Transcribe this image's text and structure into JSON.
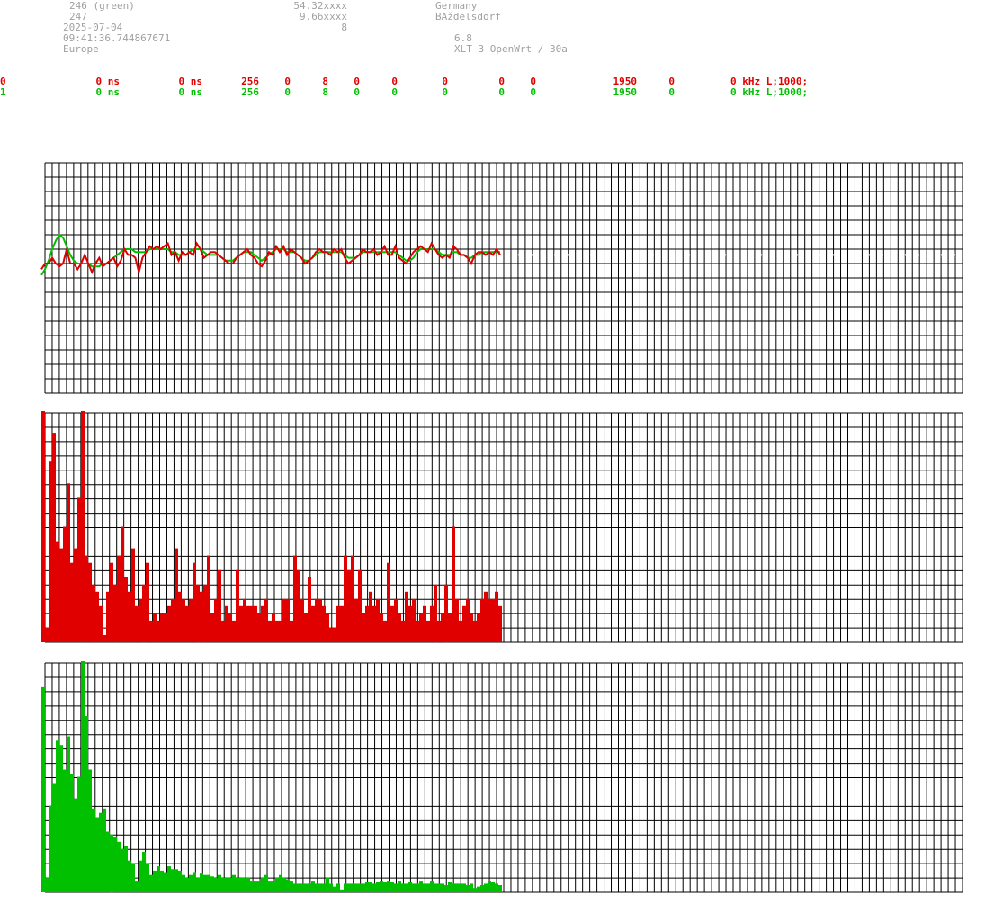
{
  "header": {
    "left": [
      "246 (green)",
      "247",
      "2025-07-04",
      "09:41:36.744867671",
      "Europe"
    ],
    "middle": [
      "54.32xxxx",
      "9.66xxxx",
      "8"
    ],
    "right": [
      "Germany",
      "BAždelsdorf",
      "",
      "6.8",
      "XLT 3 OpenWrt / 30a"
    ]
  },
  "rows": [
    {
      "id": "0",
      "v1": "0 ns",
      "v2": "0 ns",
      "n1": "256",
      "n2": "0",
      "n3": "8",
      "n4": "0",
      "n5": "0",
      "n6": "0",
      "n7": "0",
      "n8": "0",
      "freq": "1950",
      "n9": "0",
      "tail": "0 kHz L;1000;"
    },
    {
      "id": "1",
      "v1": "0 ns",
      "v2": "0 ns",
      "n1": "256",
      "n2": "0",
      "n3": "8",
      "n4": "0",
      "n5": "0",
      "n6": "0",
      "n7": "0",
      "n8": "0",
      "freq": "1950",
      "n9": "0",
      "tail": "0 kHz L;1000;"
    }
  ],
  "colors": {
    "red": "#e00000",
    "green": "#00c000",
    "grid": "#000000",
    "header_text": "#a0a0a0"
  },
  "chart_data": [
    {
      "type": "line",
      "x": [
        0,
        1,
        2,
        3,
        4,
        5,
        6,
        7,
        8,
        9,
        10,
        11,
        12,
        13,
        14,
        15,
        16,
        17,
        18,
        19,
        20,
        21,
        22,
        23,
        24,
        25,
        26,
        27,
        28,
        29,
        30,
        31,
        32,
        33,
        34,
        35,
        36,
        37,
        38,
        39,
        40,
        41,
        42,
        43,
        44,
        45,
        46,
        47,
        48,
        49,
        50,
        51,
        52,
        53,
        54,
        55,
        56,
        57,
        58,
        59,
        60,
        61,
        62,
        63,
        64,
        65,
        66,
        67,
        68,
        69,
        70,
        71,
        72,
        73,
        74,
        75,
        76,
        77,
        78,
        79,
        80,
        81,
        82,
        83,
        84,
        85,
        86,
        87,
        88,
        89,
        90,
        91,
        92,
        93,
        94,
        95,
        96,
        97,
        98,
        99,
        100,
        101,
        102,
        103,
        104,
        105,
        106,
        107,
        108,
        109,
        110,
        111,
        112,
        113,
        114,
        115,
        116,
        117,
        118,
        119,
        120,
        121,
        122,
        123,
        124,
        125,
        126,
        127
      ],
      "series": [
        {
          "values": [
            0.6,
            1.0,
            1.0,
            1.4,
            1.0,
            0.8,
            1.0,
            2.0,
            1.0,
            1.0,
            0.6,
            1.0,
            1.6,
            1.0,
            0.4,
            1.0,
            1.4,
            0.8,
            1.0,
            1.2,
            1.4,
            0.8,
            1.2,
            2.0,
            1.6,
            1.6,
            1.4,
            0.4,
            1.4,
            1.8,
            2.2,
            2.0,
            2.2,
            2.0,
            2.2,
            2.4,
            1.6,
            1.8,
            1.2,
            1.8,
            1.6,
            1.8,
            1.6,
            2.4,
            2.0,
            1.4,
            1.6,
            1.8,
            1.8,
            1.6,
            1.4,
            1.2,
            1.0,
            1.0,
            1.4,
            1.6,
            1.8,
            2.0,
            1.6,
            1.4,
            1.0,
            0.8,
            1.2,
            1.8,
            1.6,
            2.2,
            1.8,
            2.2,
            1.6,
            2.0,
            1.8,
            1.6,
            1.4,
            1.0,
            1.2,
            1.4,
            1.8,
            2.0,
            1.8,
            1.8,
            1.6,
            2.0,
            1.8,
            2.0,
            1.4,
            1.0,
            1.2,
            1.4,
            1.6,
            2.0,
            1.8,
            1.8,
            2.0,
            1.6,
            1.8,
            2.2,
            1.6,
            1.6,
            2.2,
            1.4,
            1.2,
            1.0,
            1.4,
            1.8,
            2.0,
            2.2,
            2.0,
            1.8,
            2.4,
            2.0,
            1.6,
            1.4,
            1.6,
            1.4,
            2.2,
            2.0,
            1.6,
            1.6,
            1.4,
            1.0,
            1.6,
            1.8,
            1.8,
            1.6,
            1.8,
            1.6,
            2.0,
            1.6
          ]
        },
        {
          "values": [
            0.2,
            0.6,
            1.2,
            2.0,
            2.6,
            3.0,
            2.8,
            2.2,
            1.6,
            1.2,
            1.0,
            1.0,
            1.0,
            1.0,
            0.8,
            0.8,
            0.8,
            1.0,
            1.0,
            1.2,
            1.4,
            1.6,
            1.8,
            2.0,
            2.0,
            2.0,
            1.8,
            1.8,
            1.8,
            1.8,
            2.0,
            2.0,
            2.0,
            2.0,
            2.0,
            2.0,
            1.8,
            1.8,
            1.6,
            1.6,
            1.6,
            1.8,
            2.0,
            2.0,
            2.0,
            1.8,
            1.6,
            1.6,
            1.6,
            1.6,
            1.4,
            1.2,
            1.2,
            1.2,
            1.4,
            1.6,
            1.8,
            1.8,
            1.8,
            1.6,
            1.4,
            1.2,
            1.4,
            1.6,
            1.8,
            2.0,
            2.0,
            2.0,
            1.8,
            1.8,
            1.8,
            1.6,
            1.4,
            1.2,
            1.2,
            1.4,
            1.6,
            1.8,
            1.8,
            1.8,
            1.8,
            1.8,
            1.8,
            1.8,
            1.6,
            1.4,
            1.4,
            1.4,
            1.6,
            1.8,
            1.8,
            1.8,
            1.8,
            1.8,
            1.8,
            1.8,
            1.8,
            1.8,
            1.8,
            1.6,
            1.4,
            1.2,
            1.2,
            1.4,
            1.8,
            2.0,
            2.0,
            2.0,
            2.0,
            2.0,
            1.8,
            1.6,
            1.6,
            1.6,
            1.8,
            1.8,
            1.6,
            1.6,
            1.4,
            1.4,
            1.6,
            1.6,
            1.8,
            1.8,
            1.8,
            1.8,
            1.8,
            1.8
          ]
        }
      ],
      "ylim": [
        -8,
        8
      ],
      "xlim": [
        0,
        256
      ],
      "grid": true
    },
    {
      "type": "bar",
      "x": [
        0,
        1,
        2,
        3,
        4,
        5,
        6,
        7,
        8,
        9,
        10,
        11,
        12,
        13,
        14,
        15,
        16,
        17,
        18,
        19,
        20,
        21,
        22,
        23,
        24,
        25,
        26,
        27,
        28,
        29,
        30,
        31,
        32,
        33,
        34,
        35,
        36,
        37,
        38,
        39,
        40,
        41,
        42,
        43,
        44,
        45,
        46,
        47,
        48,
        49,
        50,
        51,
        52,
        53,
        54,
        55,
        56,
        57,
        58,
        59,
        60,
        61,
        62,
        63,
        64,
        65,
        66,
        67,
        68,
        69,
        70,
        71,
        72,
        73,
        74,
        75,
        76,
        77,
        78,
        79,
        80,
        81,
        82,
        83,
        84,
        85,
        86,
        87,
        88,
        89,
        90,
        91,
        92,
        93,
        94,
        95,
        96,
        97,
        98,
        99,
        100,
        101,
        102,
        103,
        104,
        105,
        106,
        107,
        108,
        109,
        110,
        111,
        112,
        113,
        114,
        115,
        116,
        117,
        118,
        119,
        120,
        121,
        122,
        123,
        124,
        125,
        126,
        127
      ],
      "values": [
        16.0,
        1.0,
        12.5,
        14.5,
        7.0,
        6.5,
        8.0,
        11.0,
        5.5,
        6.5,
        10.0,
        16.0,
        6.0,
        5.5,
        4.0,
        3.5,
        2.5,
        0.5,
        3.5,
        5.5,
        4.0,
        6.0,
        8.0,
        4.5,
        3.5,
        6.5,
        2.5,
        3.0,
        4.0,
        5.5,
        1.5,
        2.0,
        1.5,
        2.0,
        2.0,
        2.5,
        3.0,
        6.5,
        3.5,
        3.0,
        2.5,
        3.0,
        5.5,
        4.0,
        3.5,
        4.0,
        6.0,
        2.0,
        3.0,
        5.0,
        1.5,
        2.5,
        2.0,
        1.5,
        5.0,
        2.5,
        3.0,
        2.5,
        2.5,
        2.5,
        2.0,
        2.5,
        3.0,
        1.5,
        2.0,
        1.5,
        1.5,
        3.0,
        3.0,
        1.5,
        6.0,
        5.0,
        3.0,
        2.0,
        4.5,
        2.5,
        3.0,
        3.0,
        2.5,
        2.0,
        1.0,
        1.0,
        2.5,
        2.5,
        6.0,
        5.0,
        6.0,
        3.0,
        5.0,
        2.0,
        2.5,
        3.5,
        2.5,
        3.0,
        2.0,
        1.5,
        5.5,
        2.5,
        3.0,
        2.0,
        1.5,
        3.5,
        2.5,
        3.0,
        1.5,
        2.0,
        2.5,
        1.5,
        2.5,
        4.0,
        1.5,
        2.0,
        4.0,
        2.0,
        8.0,
        3.0,
        1.5,
        2.5,
        3.0,
        2.0,
        1.5,
        2.0,
        3.0,
        3.5,
        3.0,
        3.0,
        3.5,
        2.5
      ],
      "ylim": [
        0,
        16
      ],
      "grid": true
    },
    {
      "type": "bar",
      "x": [
        0,
        1,
        2,
        3,
        4,
        5,
        6,
        7,
        8,
        9,
        10,
        11,
        12,
        13,
        14,
        15,
        16,
        17,
        18,
        19,
        20,
        21,
        22,
        23,
        24,
        25,
        26,
        27,
        28,
        29,
        30,
        31,
        32,
        33,
        34,
        35,
        36,
        37,
        38,
        39,
        40,
        41,
        42,
        43,
        44,
        45,
        46,
        47,
        48,
        49,
        50,
        51,
        52,
        53,
        54,
        55,
        56,
        57,
        58,
        59,
        60,
        61,
        62,
        63,
        64,
        65,
        66,
        67,
        68,
        69,
        70,
        71,
        72,
        73,
        74,
        75,
        76,
        77,
        78,
        79,
        80,
        81,
        82,
        83,
        84,
        85,
        86,
        87,
        88,
        89,
        90,
        91,
        92,
        93,
        94,
        95,
        96,
        97,
        98,
        99,
        100,
        101,
        102,
        103,
        104,
        105,
        106,
        107,
        108,
        109,
        110,
        111,
        112,
        113,
        114,
        115,
        116,
        117,
        118,
        119,
        120,
        121,
        122,
        123,
        124,
        125,
        126,
        127
      ],
      "values": [
        14.2,
        1.0,
        6.0,
        7.5,
        10.5,
        10.2,
        8.5,
        10.8,
        8.2,
        6.5,
        8.0,
        16.0,
        12.2,
        8.5,
        5.8,
        5.2,
        5.5,
        5.8,
        4.2,
        4.0,
        3.8,
        3.5,
        3.0,
        3.2,
        2.2,
        2.0,
        0.8,
        2.2,
        2.8,
        2.0,
        1.2,
        1.5,
        1.8,
        1.5,
        1.4,
        1.8,
        1.6,
        1.6,
        1.5,
        1.2,
        1.0,
        1.2,
        1.4,
        1.0,
        1.3,
        1.2,
        1.2,
        1.1,
        1.0,
        1.2,
        1.0,
        1.0,
        1.0,
        1.2,
        1.0,
        1.0,
        1.0,
        1.0,
        0.8,
        0.8,
        0.8,
        1.0,
        1.2,
        0.8,
        0.8,
        1.0,
        1.2,
        1.0,
        0.9,
        0.8,
        0.6,
        0.6,
        0.6,
        0.6,
        0.6,
        0.8,
        0.6,
        0.6,
        0.6,
        1.0,
        0.6,
        0.4,
        0.6,
        0.2,
        0.6,
        0.6,
        0.6,
        0.6,
        0.6,
        0.6,
        0.7,
        0.7,
        0.6,
        0.7,
        0.8,
        0.7,
        0.8,
        0.7,
        0.6,
        0.8,
        0.6,
        0.6,
        0.7,
        0.6,
        0.6,
        0.8,
        0.6,
        0.6,
        0.8,
        0.6,
        0.6,
        0.6,
        0.5,
        0.7,
        0.6,
        0.6,
        0.6,
        0.6,
        0.5,
        0.6,
        0.3,
        0.4,
        0.5,
        0.6,
        0.8,
        0.7,
        0.6,
        0.5
      ],
      "ylim": [
        0,
        16
      ],
      "grid": true
    }
  ]
}
